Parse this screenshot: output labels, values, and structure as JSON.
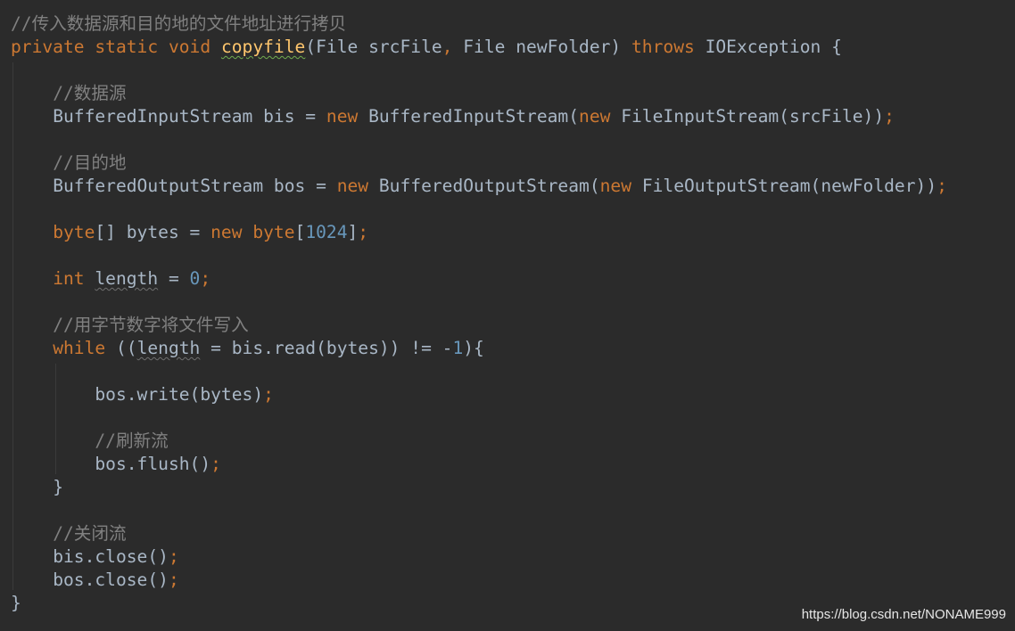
{
  "editor": {
    "theme_colors": {
      "background": "#2b2b2b",
      "comment": "#808080",
      "keyword": "#cc7832",
      "number": "#6897bb",
      "method_declaration": "#ffc66d",
      "plain": "#a9b7c6"
    },
    "lines": [
      {
        "indent": "",
        "tokens": [
          {
            "t": "comment",
            "v": "//传入数据源和目的地的文件地址进行拷贝"
          }
        ]
      },
      {
        "indent": "",
        "tokens": [
          {
            "t": "kw",
            "v": "private static void "
          },
          {
            "t": "method",
            "v": "copyfile"
          },
          {
            "t": "plain",
            "v": "(File srcFile"
          },
          {
            "t": "kw",
            "v": ", "
          },
          {
            "t": "plain",
            "v": "File newFolder) "
          },
          {
            "t": "kw",
            "v": "throws "
          },
          {
            "t": "plain",
            "v": "IOException {"
          }
        ]
      },
      {
        "indent": "    ",
        "tokens": [
          {
            "t": "comment",
            "v": "//数据源"
          }
        ]
      },
      {
        "indent": "    ",
        "tokens": [
          {
            "t": "plain",
            "v": "BufferedInputStream bis = "
          },
          {
            "t": "kw",
            "v": "new "
          },
          {
            "t": "plain",
            "v": "BufferedInputStream("
          },
          {
            "t": "kw",
            "v": "new "
          },
          {
            "t": "plain",
            "v": "FileInputStream(srcFile))"
          },
          {
            "t": "kw",
            "v": ";"
          }
        ]
      },
      {
        "indent": "    ",
        "tokens": [
          {
            "t": "comment",
            "v": "//目的地"
          }
        ]
      },
      {
        "indent": "    ",
        "tokens": [
          {
            "t": "plain",
            "v": "BufferedOutputStream bos = "
          },
          {
            "t": "kw",
            "v": "new "
          },
          {
            "t": "plain",
            "v": "BufferedOutputStream("
          },
          {
            "t": "kw",
            "v": "new "
          },
          {
            "t": "plain",
            "v": "FileOutputStream(newFolder))"
          },
          {
            "t": "kw",
            "v": ";"
          }
        ]
      },
      {
        "indent": "    ",
        "tokens": [
          {
            "t": "kw",
            "v": "byte"
          },
          {
            "t": "plain",
            "v": "[] bytes = "
          },
          {
            "t": "kw",
            "v": "new byte"
          },
          {
            "t": "plain",
            "v": "["
          },
          {
            "t": "num",
            "v": "1024"
          },
          {
            "t": "plain",
            "v": "]"
          },
          {
            "t": "kw",
            "v": ";"
          }
        ]
      },
      {
        "indent": "    ",
        "tokens": [
          {
            "t": "kw",
            "v": "int "
          },
          {
            "t": "unused",
            "v": "length"
          },
          {
            "t": "plain",
            "v": " = "
          },
          {
            "t": "num",
            "v": "0"
          },
          {
            "t": "kw",
            "v": ";"
          }
        ]
      },
      {
        "indent": "    ",
        "tokens": [
          {
            "t": "comment",
            "v": "//用字节数字将文件写入"
          }
        ]
      },
      {
        "indent": "    ",
        "tokens": [
          {
            "t": "kw",
            "v": "while "
          },
          {
            "t": "plain",
            "v": "(("
          },
          {
            "t": "unused",
            "v": "length"
          },
          {
            "t": "plain",
            "v": " = bis.read(bytes)) != -"
          },
          {
            "t": "num",
            "v": "1"
          },
          {
            "t": "plain",
            "v": "){"
          }
        ]
      },
      {
        "indent": "        ",
        "tokens": [
          {
            "t": "plain",
            "v": "bos.write(bytes)"
          },
          {
            "t": "kw",
            "v": ";"
          }
        ]
      },
      {
        "indent": "        ",
        "tokens": [
          {
            "t": "comment",
            "v": "//刷新流"
          }
        ]
      },
      {
        "indent": "        ",
        "tokens": [
          {
            "t": "plain",
            "v": "bos.flush()"
          },
          {
            "t": "kw",
            "v": ";"
          }
        ]
      },
      {
        "indent": "    ",
        "tokens": [
          {
            "t": "plain",
            "v": "}"
          }
        ]
      },
      {
        "indent": "    ",
        "tokens": [
          {
            "t": "comment",
            "v": "//关闭流"
          }
        ]
      },
      {
        "indent": "    ",
        "tokens": [
          {
            "t": "plain",
            "v": "bis.close()"
          },
          {
            "t": "kw",
            "v": ";"
          }
        ]
      },
      {
        "indent": "    ",
        "tokens": [
          {
            "t": "plain",
            "v": "bos.close()"
          },
          {
            "t": "kw",
            "v": ";"
          }
        ]
      },
      {
        "indent": "",
        "tokens": [
          {
            "t": "plain",
            "v": "}"
          }
        ]
      }
    ]
  },
  "watermark": {
    "text": "https://blog.csdn.net/NONAME999"
  }
}
